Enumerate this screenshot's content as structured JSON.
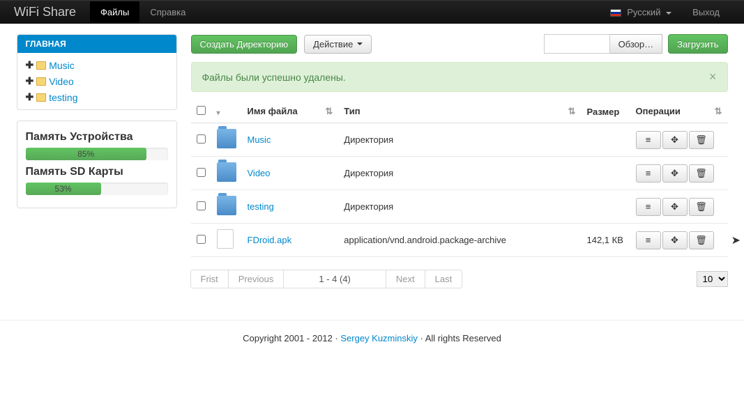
{
  "navbar": {
    "brand": "WiFi Share",
    "files": "Файлы",
    "help": "Справка",
    "language": "Русский",
    "logout": "Выход"
  },
  "sidebar": {
    "home_label": "ГЛАВНАЯ",
    "tree": [
      {
        "label": "Music"
      },
      {
        "label": "Video"
      },
      {
        "label": "testing"
      }
    ],
    "storage": [
      {
        "title": "Память Устройства",
        "percent": 85,
        "text": "85%"
      },
      {
        "title": "Память SD Карты",
        "percent": 53,
        "text": "53%"
      }
    ]
  },
  "toolbar": {
    "create_dir": "Создать Директорию",
    "action": "Действие",
    "browse": "Обзор…",
    "upload": "Загрузить"
  },
  "alert": {
    "message": "Файлы были успешно удалены."
  },
  "table": {
    "headers": {
      "name": "Имя файла",
      "type": "Тип",
      "size": "Размер",
      "ops": "Операции"
    },
    "rows": [
      {
        "name": "Music",
        "type": "Директория",
        "size": "",
        "icon": "folder"
      },
      {
        "name": "Video",
        "type": "Директория",
        "size": "",
        "icon": "folder"
      },
      {
        "name": "testing",
        "type": "Директория",
        "size": "",
        "icon": "folder"
      },
      {
        "name": "FDroid.apk",
        "type": "application/vnd.android.package-archive",
        "size": "142,1 КВ",
        "icon": "file"
      }
    ]
  },
  "pagination": {
    "first": "Frist",
    "previous": "Previous",
    "info": "1 - 4 (4)",
    "next": "Next",
    "last": "Last",
    "page_size": "10"
  },
  "footer": {
    "copyright_pre": "Copyright 2001 - 2012 · ",
    "author": "Sergey Kuzminskiy",
    "copyright_post": " · All rights Reserved"
  }
}
